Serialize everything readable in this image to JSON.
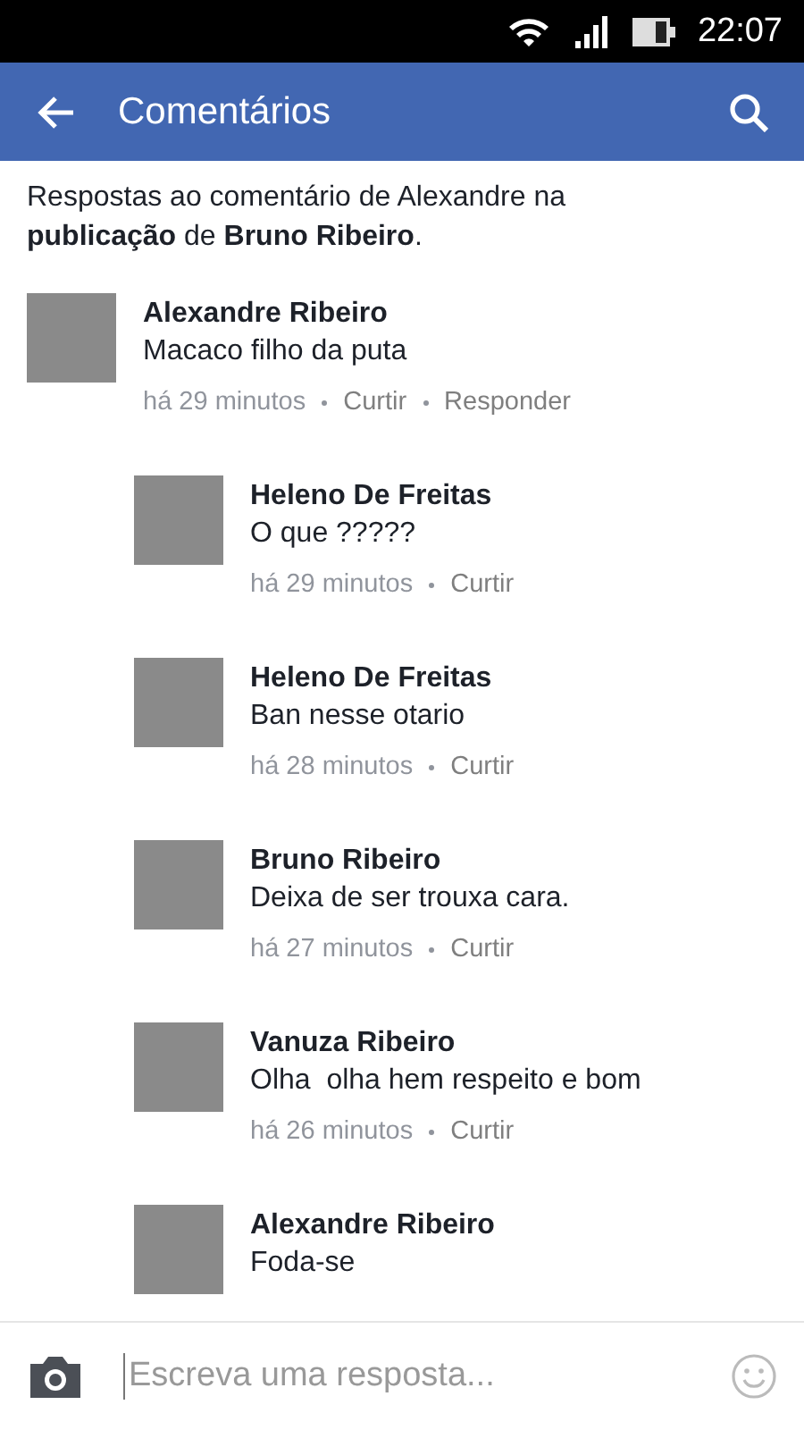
{
  "status_bar": {
    "time": "22:07"
  },
  "header": {
    "title": "Comentários"
  },
  "intro": "Respostas ao comentário de Alexandre na **publicação** de **Bruno Ribeiro**.",
  "comments": [
    {
      "author": "Alexandre Ribeiro",
      "text": "Macaco filho da puta",
      "time": "há 29 minutos",
      "actions": [
        "Curtir",
        "Responder"
      ],
      "children": [
        {
          "author": "Heleno De Freitas",
          "text": "O que ?????",
          "time": "há 29 minutos",
          "actions": [
            "Curtir"
          ]
        },
        {
          "author": "Heleno De Freitas",
          "text": "Ban nesse otario",
          "time": "há 28 minutos",
          "actions": [
            "Curtir"
          ]
        },
        {
          "author": "Bruno Ribeiro",
          "text": "Deixa de ser trouxa cara.",
          "time": "há 27 minutos",
          "actions": [
            "Curtir"
          ]
        },
        {
          "author": "Vanuza Ribeiro",
          "text": "Olha  olha hem respeito e bom",
          "time": "há 26 minutos",
          "actions": [
            "Curtir"
          ]
        },
        {
          "author": "Alexandre Ribeiro",
          "text": "Foda-se"
        }
      ]
    }
  ],
  "reply_bar": {
    "placeholder": "Escreva uma resposta..."
  }
}
